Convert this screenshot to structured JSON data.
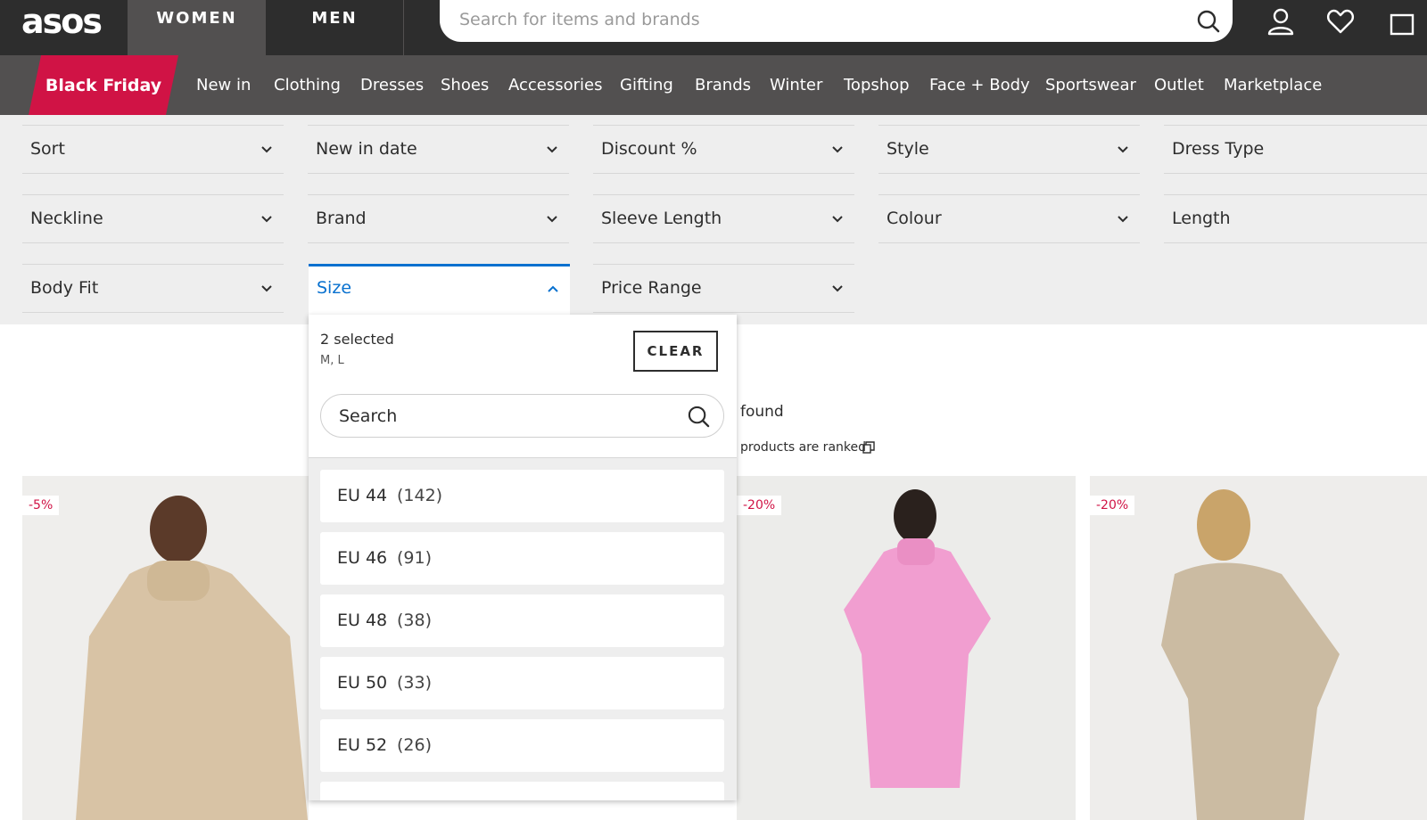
{
  "brand": {
    "logo_text": "asos"
  },
  "gender_tabs": [
    "WOMEN",
    "MEN"
  ],
  "search": {
    "placeholder": "Search for items and brands"
  },
  "nav": {
    "featured": "Black Friday",
    "items": [
      "New in",
      "Clothing",
      "Dresses",
      "Shoes",
      "Accessories",
      "Gifting",
      "Brands",
      "Winter",
      "Topshop",
      "Face + Body",
      "Sportswear",
      "Outlet",
      "Marketplace"
    ]
  },
  "filters": {
    "row1": [
      "Sort",
      "New in date",
      "Discount %",
      "Style",
      "Dress Type"
    ],
    "row2": [
      "Neckline",
      "Brand",
      "Sleeve Length",
      "Colour",
      "Length"
    ],
    "row3": [
      "Body Fit",
      "Size",
      "Price Range"
    ]
  },
  "size_dropdown": {
    "selected_count": "2 selected",
    "selected_values": "M, L",
    "clear_label": "CLEAR",
    "search_placeholder": "Search",
    "options": [
      {
        "label": "EU 44",
        "count": "(142)"
      },
      {
        "label": "EU 46",
        "count": "(91)"
      },
      {
        "label": "EU 48",
        "count": "(38)"
      },
      {
        "label": "EU 50",
        "count": "(33)"
      },
      {
        "label": "EU 52",
        "count": "(26)"
      }
    ]
  },
  "results": {
    "found_text": "found",
    "ranked_text": "products are ranked"
  },
  "products": [
    {
      "discount": "-5%"
    },
    {
      "discount": "-20%"
    },
    {
      "discount": "-20%"
    }
  ],
  "colors": {
    "dark": "#2d2d2d",
    "nav": "#525050",
    "accent": "#d01345",
    "active_blue": "#0770cf"
  }
}
